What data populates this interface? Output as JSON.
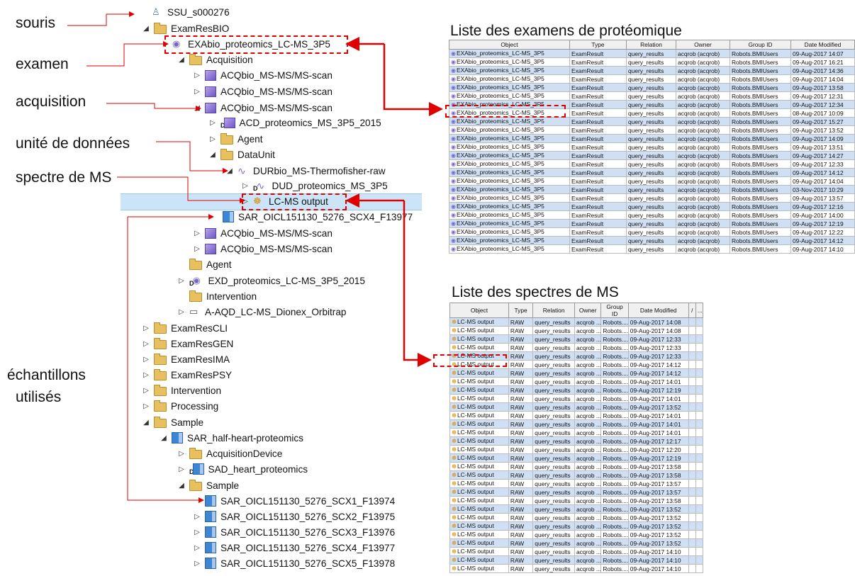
{
  "annotations": {
    "souris": "souris",
    "examen": "examen",
    "acquisition": "acquisition",
    "unite": "unité de données",
    "spectre": "spectre de MS",
    "echantillons_1": "échantillons",
    "echantillons_2": "utilisés"
  },
  "tree": [
    {
      "label": "SSU_s000276",
      "icon": "person",
      "exp": ""
    },
    {
      "label": "ExamResBIO",
      "icon": "folder",
      "exp": "◢"
    },
    {
      "label": "EXAbio_proteomics_LC-MS_3P5",
      "icon": "eye",
      "exp": ""
    },
    {
      "label": "Acquisition",
      "icon": "folder",
      "exp": "◢"
    },
    {
      "label": "ACQbio_MS-MS/MS-scan",
      "icon": "cube",
      "exp": "▷"
    },
    {
      "label": "ACQbio_MS-MS/MS-scan",
      "icon": "cube",
      "exp": "▷"
    },
    {
      "label": "ACQbio_MS-MS/MS-scan",
      "icon": "cube",
      "exp": "◢"
    },
    {
      "label": "ACD_proteomics_MS_3P5_2015",
      "icon": "cube",
      "exp": "▷",
      "pre": "D"
    },
    {
      "label": "Agent",
      "icon": "folder",
      "exp": "▷"
    },
    {
      "label": "DataUnit",
      "icon": "folder",
      "exp": "◢"
    },
    {
      "label": "DURbio_MS-Thermofisher-raw",
      "icon": "wave",
      "exp": "◢"
    },
    {
      "label": "DUD_proteomics_MS_3P5",
      "icon": "wave",
      "exp": "▷",
      "pre": "D"
    },
    {
      "label": "LC-MS output",
      "icon": "gear",
      "exp": "▷"
    },
    {
      "label": "SAR_OICL151130_5276_SCX4_F13977",
      "icon": "sample",
      "exp": ""
    },
    {
      "label": "ACQbio_MS-MS/MS-scan",
      "icon": "cube",
      "exp": "▷"
    },
    {
      "label": "ACQbio_MS-MS/MS-scan",
      "icon": "cube",
      "exp": "▷"
    },
    {
      "label": "Agent",
      "icon": "folder",
      "exp": ""
    },
    {
      "label": "EXD_proteomics_LC-MS_3P5_2015",
      "icon": "eye",
      "exp": "▷",
      "pre": "D"
    },
    {
      "label": "Intervention",
      "icon": "folder",
      "exp": ""
    },
    {
      "label": "A-AQD_LC-MS_Dionex_Orbitrap",
      "icon": "monitor",
      "exp": "▷"
    },
    {
      "label": "ExamResCLI",
      "icon": "folder",
      "exp": "▷"
    },
    {
      "label": "ExamResGEN",
      "icon": "folder",
      "exp": "▷"
    },
    {
      "label": "ExamResIMA",
      "icon": "folder",
      "exp": "▷"
    },
    {
      "label": "ExamResPSY",
      "icon": "folder",
      "exp": "▷"
    },
    {
      "label": "Intervention",
      "icon": "folder",
      "exp": "▷"
    },
    {
      "label": "Processing",
      "icon": "folder",
      "exp": "▷"
    },
    {
      "label": "Sample",
      "icon": "folder",
      "exp": "◢"
    },
    {
      "label": "SAR_half-heart-proteomics",
      "icon": "sample",
      "exp": "◢"
    },
    {
      "label": "AcquisitionDevice",
      "icon": "folder",
      "exp": "▷"
    },
    {
      "label": "SAD_heart_proteomics",
      "icon": "sample",
      "exp": "▷",
      "pre": "D"
    },
    {
      "label": "Sample",
      "icon": "folder",
      "exp": "◢"
    },
    {
      "label": "SAR_OICL151130_5276_SCX1_F13974",
      "icon": "sample",
      "exp": ""
    },
    {
      "label": "SAR_OICL151130_5276_SCX2_F13975",
      "icon": "sample",
      "exp": "▷"
    },
    {
      "label": "SAR_OICL151130_5276_SCX3_F13976",
      "icon": "sample",
      "exp": "▷"
    },
    {
      "label": "SAR_OICL151130_5276_SCX4_F13977",
      "icon": "sample",
      "exp": "▷"
    },
    {
      "label": "SAR_OICL151130_5276_SCX5_F13978",
      "icon": "sample",
      "exp": "▷"
    }
  ],
  "exams_table": {
    "title": "Liste des examens de protéomique",
    "headers": [
      "Object",
      "Type",
      "Relation",
      "Owner",
      "Group ID",
      "Date Modified"
    ],
    "object": "EXAbio_proteomics_LC-MS_3P5",
    "type": "ExamResult",
    "relation": "query_results",
    "owner": "acqrob (acqrob)",
    "group": "Robots.BMIUsers",
    "dates": [
      "09-Aug-2017 14:07",
      "09-Aug-2017 16:21",
      "09-Aug-2017 14:36",
      "09-Aug-2017 14:04",
      "09-Aug-2017 13:58",
      "09-Aug-2017 12:31",
      "09-Aug-2017 12:34",
      "08-Aug-2017 10:09",
      "09-Aug-2017 15:27",
      "09-Aug-2017 13:52",
      "09-Aug-2017 14:09",
      "09-Aug-2017 13:51",
      "09-Aug-2017 14:27",
      "09-Aug-2017 12:33",
      "09-Aug-2017 14:12",
      "09-Aug-2017 14:04",
      "03-Nov-2017 10:29",
      "09-Aug-2017 13:57",
      "09-Aug-2017 12:16",
      "09-Aug-2017 14:00",
      "09-Aug-2017 12:19",
      "09-Aug-2017 12:22",
      "09-Aug-2017 14:12",
      "09-Aug-2017 14:10"
    ]
  },
  "spectra_table": {
    "title": "Liste des spectres de MS",
    "headers": [
      "Object",
      "Type",
      "Relation",
      "Owner",
      "Group ID",
      "Date Modified",
      "/",
      "..."
    ],
    "object": "LC-MS output",
    "type": "RAW",
    "relation": "query_results",
    "owner": "acqrob ...",
    "group": "Robots....",
    "dates": [
      "09-Aug-2017 14:08",
      "09-Aug-2017 14:08",
      "09-Aug-2017 12:33",
      "09-Aug-2017 12:33",
      "09-Aug-2017 12:33",
      "09-Aug-2017 14:12",
      "09-Aug-2017 14:12",
      "09-Aug-2017 14:01",
      "09-Aug-2017 12:19",
      "09-Aug-2017 14:01",
      "09-Aug-2017 13:52",
      "09-Aug-2017 14:01",
      "09-Aug-2017 14:01",
      "09-Aug-2017 14:01",
      "09-Aug-2017 12:17",
      "09-Aug-2017 12:20",
      "09-Aug-2017 12:19",
      "09-Aug-2017 13:58",
      "09-Aug-2017 13:58",
      "09-Aug-2017 13:57",
      "09-Aug-2017 13:57",
      "09-Aug-2017 13:58",
      "09-Aug-2017 13:52",
      "09-Aug-2017 13:52",
      "09-Aug-2017 13:52",
      "09-Aug-2017 13:52",
      "09-Aug-2017 13:52",
      "09-Aug-2017 14:10",
      "09-Aug-2017 14:10",
      "09-Aug-2017 14:10"
    ]
  },
  "colors": {
    "arrow": "#e00000",
    "row_alt": "#cfe0f5",
    "selection": "#cce4f7"
  }
}
